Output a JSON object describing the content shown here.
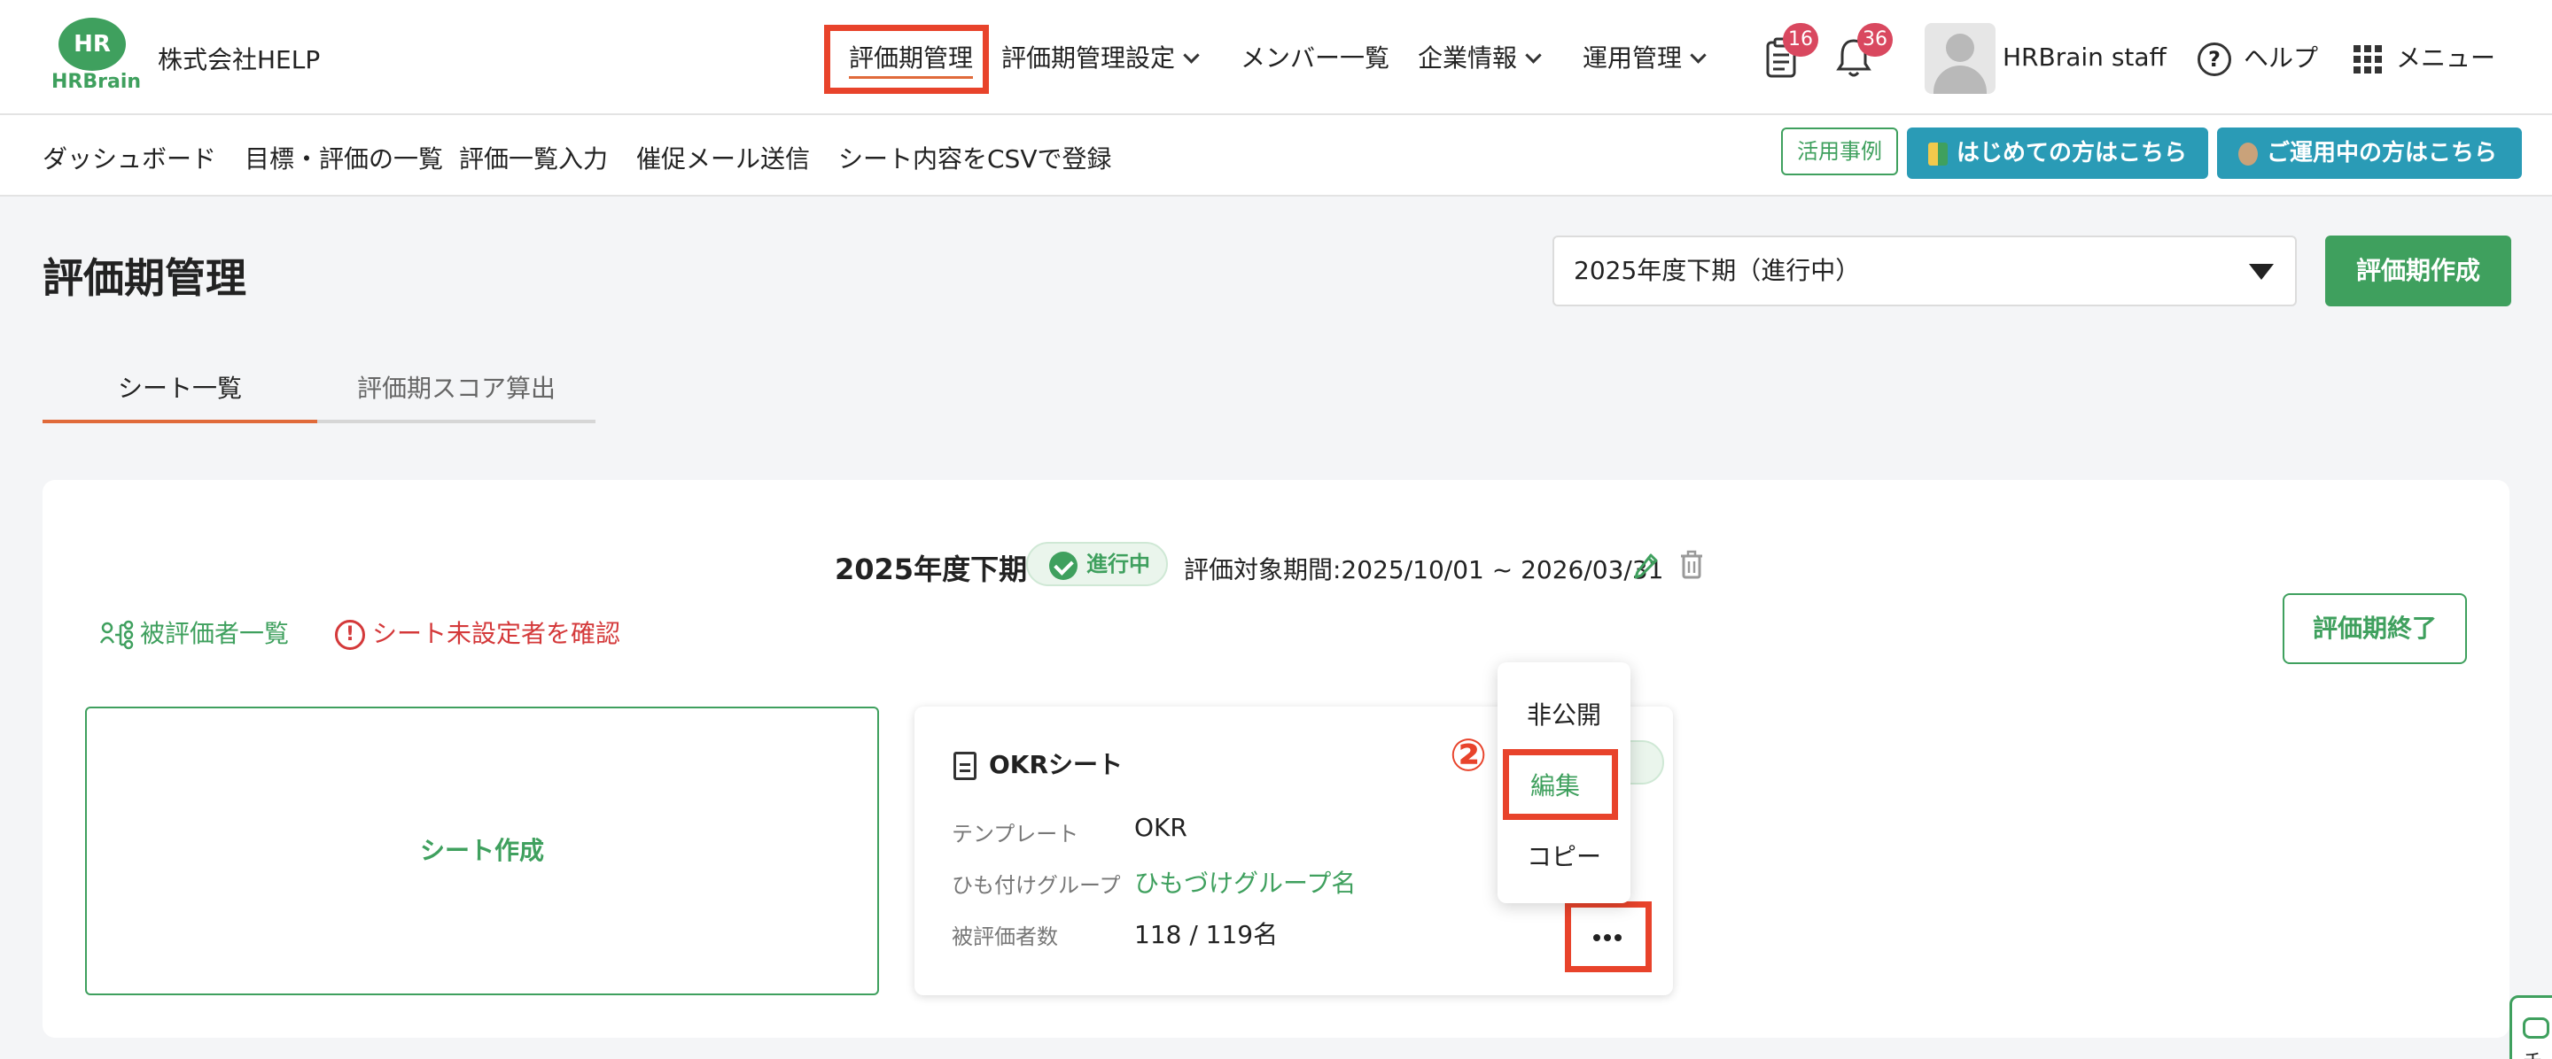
{
  "header": {
    "logo_text": "HR",
    "logo_brand": "HRBrain",
    "company": "株式会社HELP",
    "nav": [
      {
        "label": "評価期管理",
        "dropdown": false,
        "active": true
      },
      {
        "label": "評価期管理設定",
        "dropdown": true
      },
      {
        "label": "メンバー一覧",
        "dropdown": false
      },
      {
        "label": "企業情報",
        "dropdown": true
      },
      {
        "label": "運用管理",
        "dropdown": true
      }
    ],
    "todo_badge": "16",
    "notification_badge": "36",
    "username": "HRBrain staff",
    "help_label": "ヘルプ",
    "menu_label": "メニュー"
  },
  "subnav": {
    "items": [
      "ダッシュボード",
      "目標・評価の一覧",
      "評価一覧入力",
      "催促メール送信",
      "シート内容をCSVで登録"
    ],
    "case_button": "活用事例",
    "beginner_button": "はじめての方はこちら",
    "operating_button": "ご運用中の方はこちら"
  },
  "page": {
    "title": "評価期管理",
    "period_select": "2025年度下期（進行中）",
    "create_period_button": "評価期作成",
    "tabs": [
      {
        "label": "シート一覧",
        "active": true
      },
      {
        "label": "評価期スコア算出",
        "active": false
      }
    ]
  },
  "period": {
    "name": "2025年度下期",
    "status": "進行中",
    "range": "評価対象期間:2025/10/01 ~ 2026/03/31",
    "reviewee_link": "被評価者一覧",
    "unset_link": "シート未設定者を確認",
    "end_button": "評価期終了"
  },
  "sheet_create_label": "シート作成",
  "sheet_card": {
    "title": "OKRシート",
    "rows": [
      {
        "label": "テンプレート",
        "value": "OKR",
        "link": false
      },
      {
        "label": "ひも付けグループ",
        "value": "ひもづけグループ名",
        "link": true
      },
      {
        "label": "被評価者数",
        "value": "118 / 119名",
        "link": false
      }
    ]
  },
  "popup_menu": [
    "非公開",
    "編集",
    "コピー"
  ],
  "annotation": {
    "step": "②"
  },
  "chat_tab_char": "チ",
  "colors": {
    "brand_green": "#3fa05e",
    "accent_orange": "#e06a3a",
    "highlight_red": "#e8432b",
    "teal": "#2a9bb6",
    "badge": "#d9485f"
  }
}
